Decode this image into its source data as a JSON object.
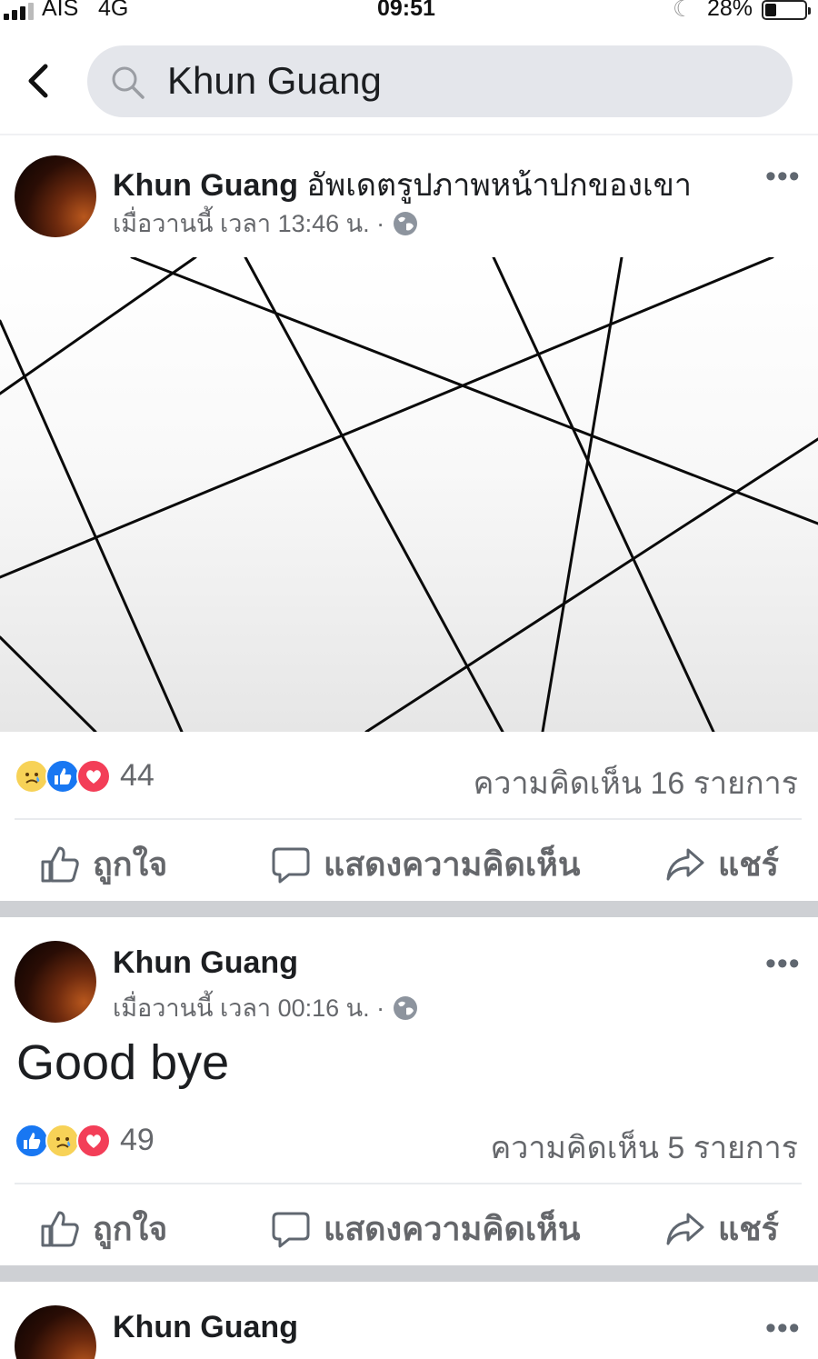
{
  "status_bar": {
    "carrier": "AIS",
    "network": "4G",
    "time": "09:51",
    "battery_percent": "28%",
    "icons": [
      "signal-icon",
      "moon-icon",
      "battery-icon"
    ]
  },
  "header": {
    "back_icon": "chevron-left-icon",
    "search_icon": "search-icon",
    "search_value": "Khun Guang"
  },
  "posts": [
    {
      "author": "Khun Guang",
      "action": " อัพเดตรูปภาพหน้าปกของเขา",
      "time": "เมื่อวานนี้ เวลา 13:46 น. ·",
      "privacy_icon": "globe-icon",
      "image": "cover-photo-black-lines-on-white",
      "reactions": [
        "sad",
        "like",
        "love"
      ],
      "reaction_count": "44",
      "comments": "ความคิดเห็น 16 รายการ"
    },
    {
      "author": "Khun Guang",
      "action": "",
      "time": "เมื่อวานนี้ เวลา 00:16 น. ·",
      "privacy_icon": "globe-icon",
      "text": "Good bye",
      "reactions": [
        "like",
        "sad",
        "love"
      ],
      "reaction_count": "49",
      "comments": "ความคิดเห็น 5 รายการ"
    },
    {
      "author": "Khun Guang"
    }
  ],
  "actions": {
    "like": "ถูกใจ",
    "comment": "แสดงความคิดเห็น",
    "share": "แชร์"
  },
  "colors": {
    "facebook_blue": "#1877f2",
    "love_red": "#f33e58",
    "sad_yellow": "#f7d257",
    "secondary_text": "#65676b",
    "search_bg": "#e4e6eb",
    "separator": "#ced0d4"
  }
}
